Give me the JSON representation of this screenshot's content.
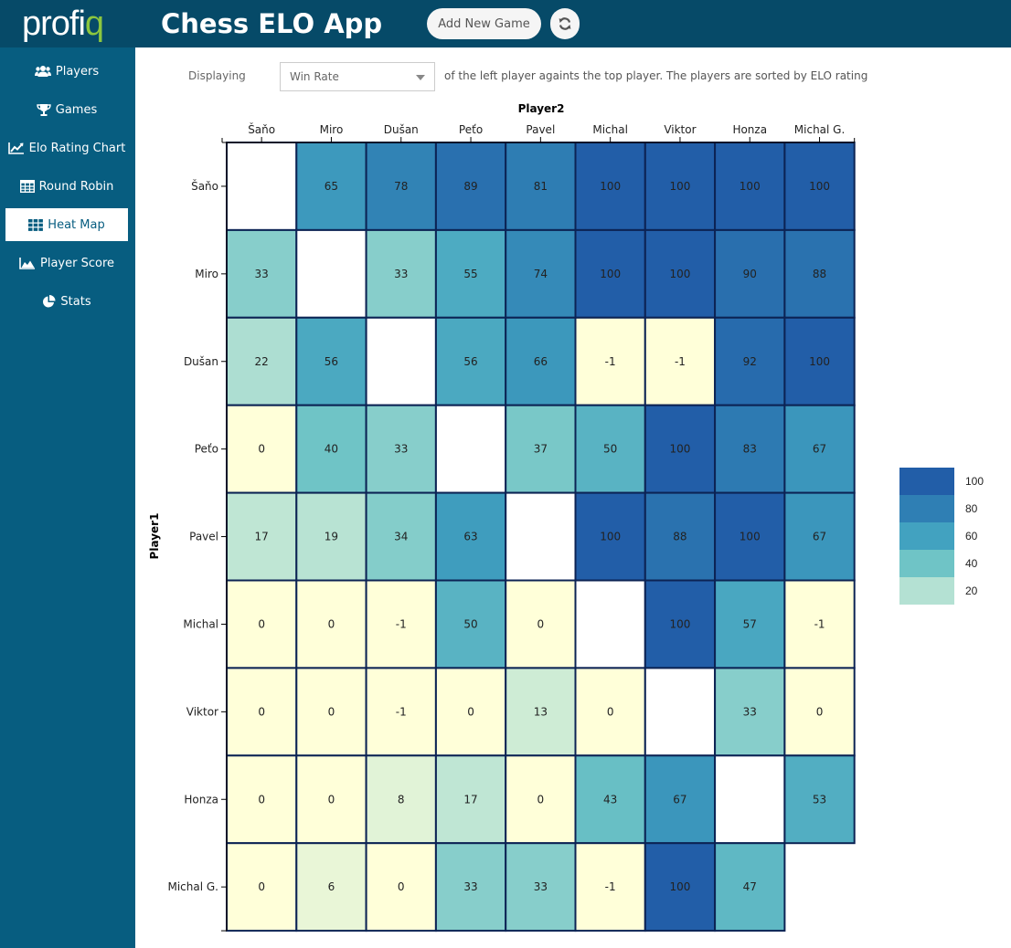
{
  "header": {
    "logo_text_main": "profi",
    "logo_text_accent": "q",
    "title": "Chess ELO App",
    "add_game_label": "Add New Game",
    "refresh_icon": "refresh-icon"
  },
  "sidebar": {
    "items": [
      {
        "label": "Players",
        "icon": "users-icon",
        "active": false
      },
      {
        "label": "Games",
        "icon": "trophy-icon",
        "active": false
      },
      {
        "label": "Elo Rating Chart",
        "icon": "line-chart-icon",
        "active": false
      },
      {
        "label": "Round Robin",
        "icon": "table-icon",
        "active": false
      },
      {
        "label": "Heat Map",
        "icon": "grid-icon",
        "active": true
      },
      {
        "label": "Player Score",
        "icon": "area-chart-icon",
        "active": false
      },
      {
        "label": "Stats",
        "icon": "pie-chart-icon",
        "active": false
      }
    ]
  },
  "controls": {
    "displaying_label": "Displaying",
    "metric_selected": "Win Rate",
    "description": "of the left player againts the top player. The players are sorted by ELO rating"
  },
  "colors": {
    "header_bg": "#064a68",
    "sidebar_bg": "#075d80",
    "logo_accent": "#8cc63f",
    "cell_border": "#0c2354",
    "scale": [
      "#ffffd9",
      "#b4e1d3",
      "#6fc4c6",
      "#42a2c0",
      "#2f7fb4",
      "#225ea8"
    ]
  },
  "chart_data": {
    "type": "heatmap",
    "title": "",
    "xlabel": "Player2",
    "ylabel": "Player1",
    "x": [
      "Šaňo",
      "Miro",
      "Dušan",
      "Peťo",
      "Pavel",
      "Michal",
      "Viktor",
      "Honza",
      "Michal G."
    ],
    "y": [
      "Šaňo",
      "Miro",
      "Dušan",
      "Peťo",
      "Pavel",
      "Michal",
      "Viktor",
      "Honza",
      "Michal G."
    ],
    "values": [
      [
        null,
        65,
        78,
        89,
        81,
        100,
        100,
        100,
        100
      ],
      [
        33,
        null,
        33,
        55,
        74,
        100,
        100,
        90,
        88
      ],
      [
        22,
        56,
        null,
        56,
        66,
        -1,
        -1,
        92,
        100
      ],
      [
        0,
        40,
        33,
        null,
        37,
        50,
        100,
        83,
        67
      ],
      [
        17,
        19,
        34,
        63,
        null,
        100,
        88,
        100,
        67
      ],
      [
        0,
        0,
        -1,
        50,
        0,
        null,
        100,
        57,
        -1
      ],
      [
        0,
        0,
        -1,
        0,
        13,
        0,
        null,
        33,
        0
      ],
      [
        0,
        0,
        8,
        17,
        0,
        43,
        67,
        null,
        53
      ],
      [
        0,
        6,
        0,
        33,
        33,
        -1,
        100,
        47,
        null
      ]
    ],
    "diagonal_drawn_blank": [
      true,
      true,
      true,
      true,
      true,
      true,
      true,
      true,
      false
    ],
    "color_range": [
      0,
      100
    ],
    "legend": {
      "position": "right",
      "entries": [
        100,
        80,
        60,
        40,
        20
      ]
    }
  }
}
